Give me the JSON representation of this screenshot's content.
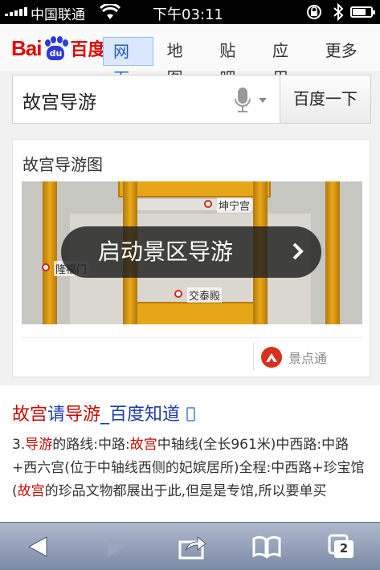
{
  "status_bar": {
    "carrier": "中国联通",
    "time": "下午03:11"
  },
  "header": {
    "logo": {
      "text_left": "Bai",
      "paw_text": "du",
      "text_right": "百度"
    },
    "tabs": [
      {
        "label": "网页",
        "active": true
      },
      {
        "label": "地图"
      },
      {
        "label": "贴吧"
      },
      {
        "label": "应用"
      },
      {
        "label": "更多"
      }
    ]
  },
  "search": {
    "query": "故宫导游",
    "button_label": "百度一下"
  },
  "guide_card": {
    "title": "故宫导游图",
    "map_labels": {
      "kunning": "坤宁宫",
      "jiaotai": "交泰殿",
      "gate": "隆福门"
    },
    "start_button": "启动景区导游",
    "source": "景点通"
  },
  "result": {
    "title_parts": [
      "故宫",
      "请",
      "导游",
      "_百度知道"
    ],
    "body_parts": [
      "3.",
      "导游",
      "的路线:中路:",
      "故宫",
      "中轴线(全长961米)中西路:中路+西六宫(位于中轴线西侧的妃嫔居所)全程:中西路+珍宝馆(",
      "故宫",
      "的珍品文物都展出于此,但是是专馆,所以要单买"
    ]
  },
  "toolbar": {
    "tabs_count": "2"
  },
  "colors": {
    "baidu_red": "#e10601",
    "baidu_blue": "#2b3bd5",
    "link_blue": "#1d3ba6",
    "highlight_red": "#c60a00"
  }
}
